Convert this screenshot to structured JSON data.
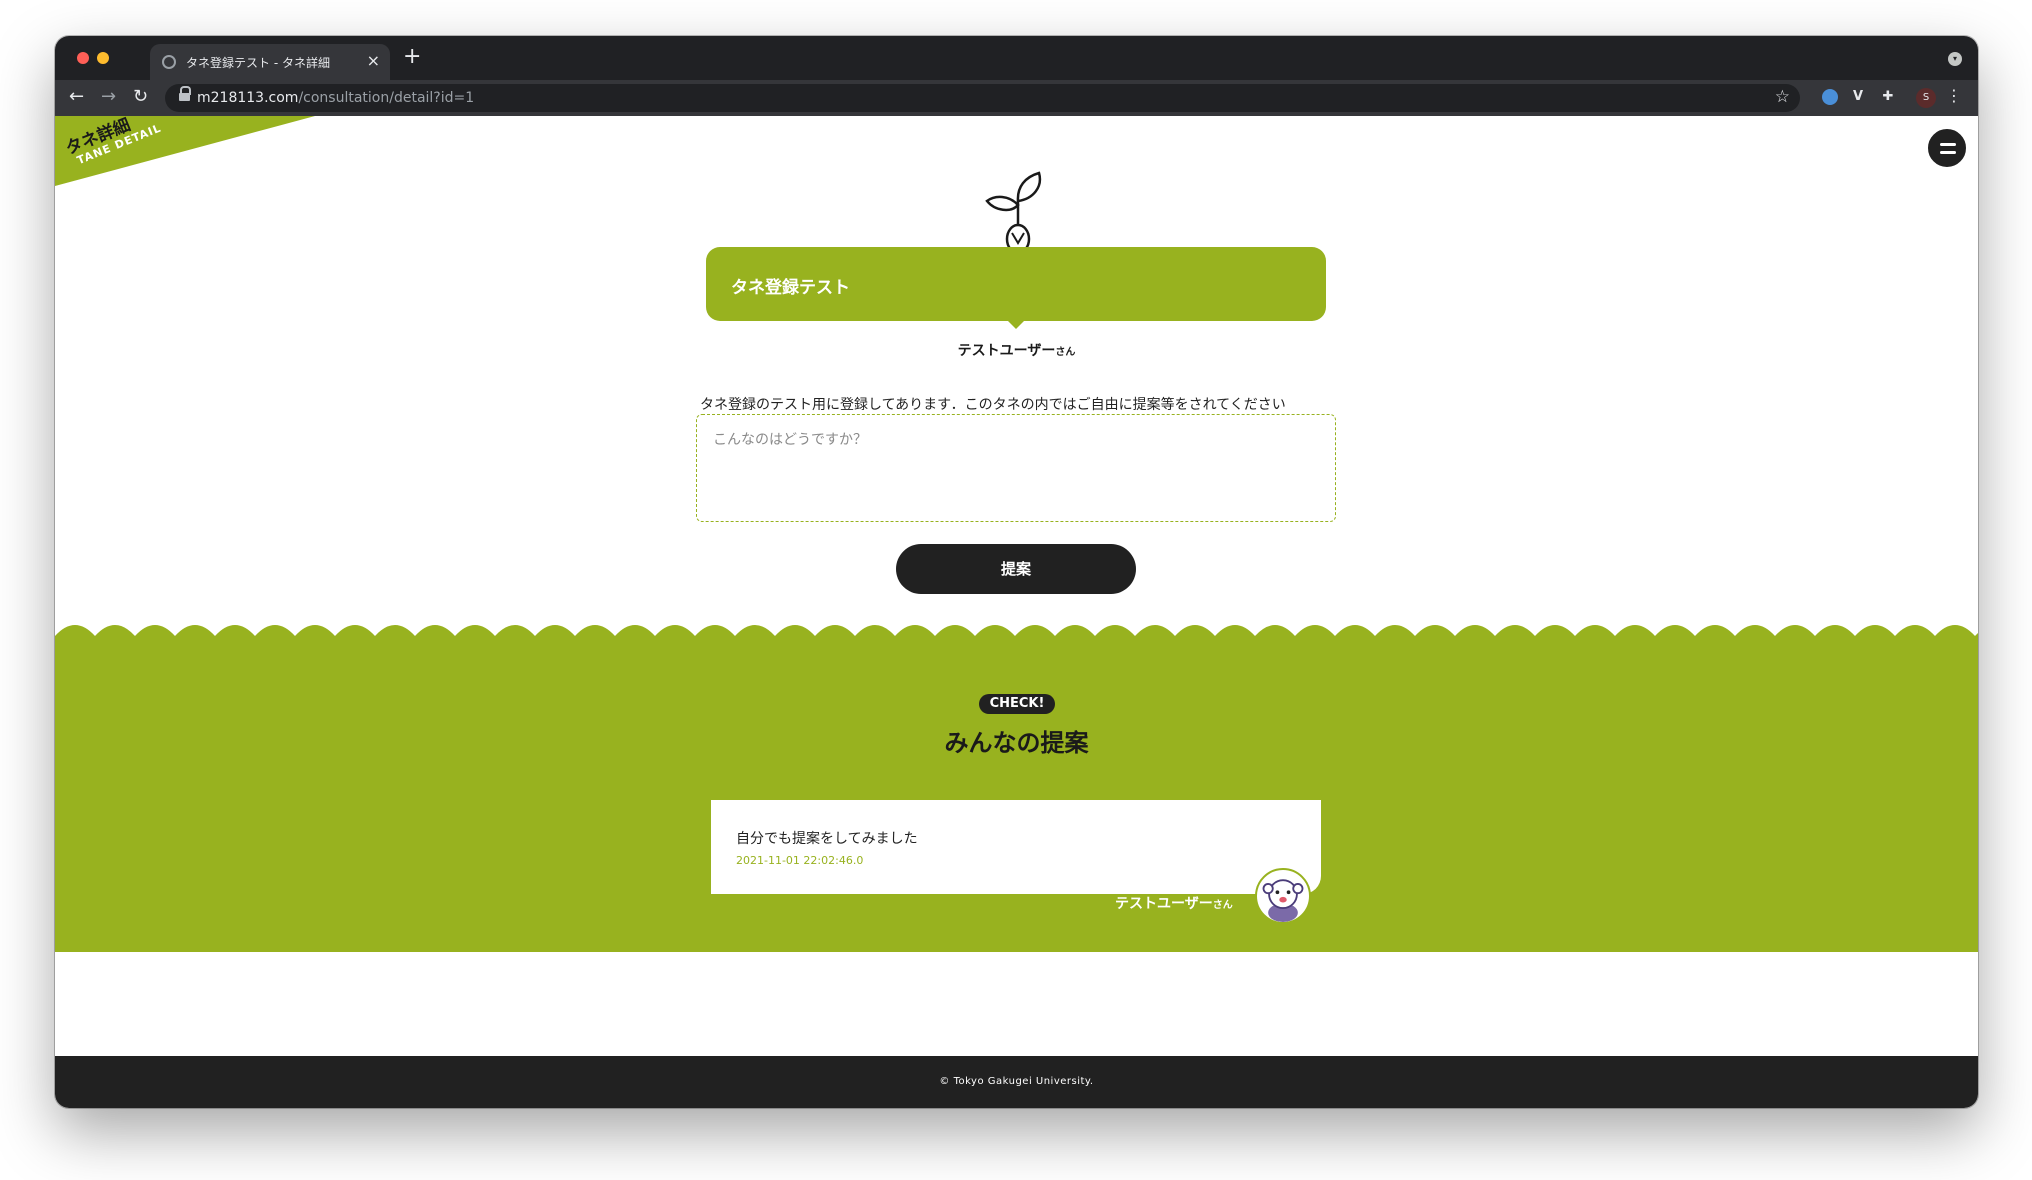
{
  "browser": {
    "tab_title": "タネ登録テスト - タネ詳細",
    "tab_close": "×",
    "new_tab": "+",
    "url_host": "m218113.com",
    "url_path": "/consultation/detail?id=1",
    "back": "←",
    "forward": "→",
    "reload": "↻",
    "bookmark": "☆",
    "profile_initial": "S",
    "menu": "⋮",
    "extension_puzzle": "✚",
    "extension_v": "V"
  },
  "corner": {
    "jp": "タネ詳細",
    "en": "TANE DETAIL"
  },
  "tane": {
    "title": "タネ登録テスト",
    "author_name": "テストユーザー",
    "author_suffix": "さん",
    "description": "タネ登録のテスト用に登録してあります．このタネの内ではご自由に提案等をされてください",
    "proposal_placeholder": "こんなのはどうですか？",
    "submit_label": "提案"
  },
  "proposals": {
    "badge": "CHECK!",
    "title": "みんなの提案",
    "items": [
      {
        "text": "自分でも提案をしてみました",
        "date": "2021-11-01 22:02:46.0",
        "author_name": "テストユーザー",
        "author_suffix": "さん"
      }
    ]
  },
  "footer": {
    "copyright": "© Tokyo Gakugei University."
  },
  "colors": {
    "accent": "#98b21f",
    "dark": "#212121",
    "chrome_bg": "#202124"
  },
  "icons": [
    "globe-icon",
    "lock-icon",
    "star-icon",
    "menu-icon",
    "sprout-icon",
    "avatar-icon"
  ]
}
